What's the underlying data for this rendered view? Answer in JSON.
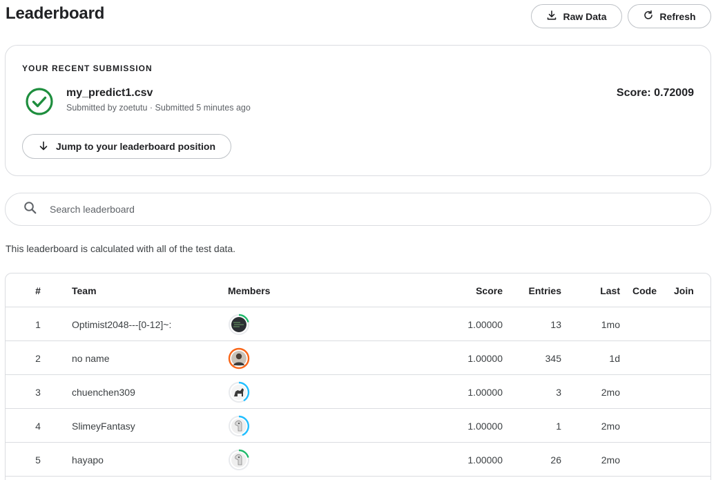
{
  "header": {
    "title": "Leaderboard",
    "raw_data_label": "Raw Data",
    "refresh_label": "Refresh"
  },
  "submission": {
    "heading": "YOUR RECENT SUBMISSION",
    "file_name": "my_predict1.csv",
    "meta": "Submitted by zoetutu · Submitted 5 minutes ago",
    "score": "Score: 0.72009",
    "jump_label": "Jump to your leaderboard position",
    "status_color": "#1e8e3e"
  },
  "search": {
    "placeholder": "Search leaderboard",
    "value": ""
  },
  "note": "This leaderboard is calculated with all of the test data.",
  "table": {
    "columns": {
      "rank": "#",
      "team": "Team",
      "members": "Members",
      "score": "Score",
      "entries": "Entries",
      "last": "Last",
      "code": "Code",
      "join": "Join"
    },
    "rows": [
      {
        "rank": "1",
        "team": "Optimist2048---[0-12]~:",
        "score": "1.00000",
        "entries": "13",
        "last": "1mo",
        "ring_color": "#20beff",
        "tier_color": "#1eb86a"
      },
      {
        "rank": "2",
        "team": "no name",
        "score": "1.00000",
        "entries": "345",
        "last": "1d",
        "ring_color": "#f96517",
        "tier_color": "#f96517"
      },
      {
        "rank": "3",
        "team": "chuenchen309",
        "score": "1.00000",
        "entries": "3",
        "last": "2mo",
        "ring_color": "#20beff",
        "tier_color": "#20beff"
      },
      {
        "rank": "4",
        "team": "SlimeyFantasy",
        "score": "1.00000",
        "entries": "1",
        "last": "2mo",
        "ring_color": "#20beff",
        "tier_color": "#20beff"
      },
      {
        "rank": "5",
        "team": "hayapo",
        "score": "1.00000",
        "entries": "26",
        "last": "2mo",
        "ring_color": "#20beff",
        "tier_color": "#1eb86a"
      }
    ]
  }
}
